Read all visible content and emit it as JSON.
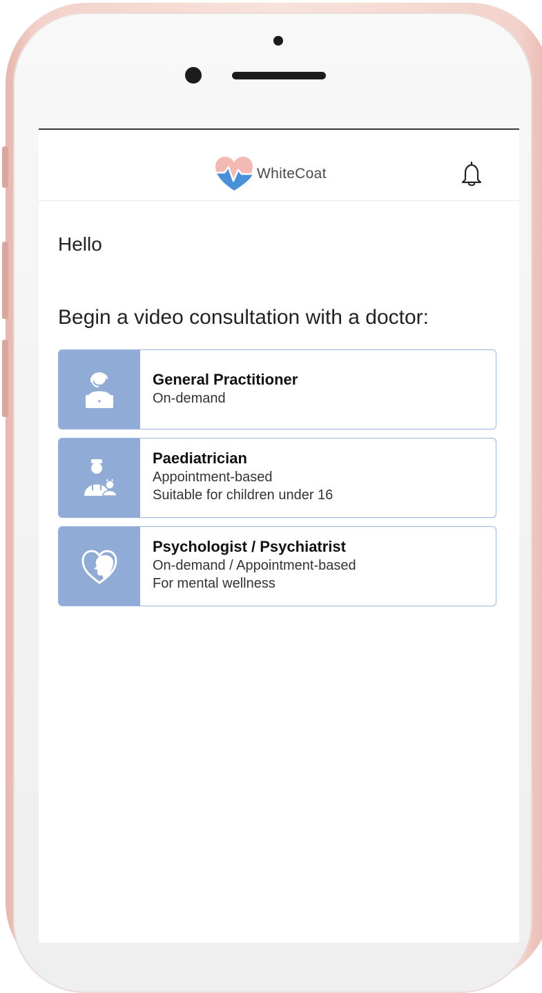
{
  "app": {
    "brand_name": "WhiteCoat",
    "brand_colors": {
      "heart_pink": "#f3b9b3",
      "heart_blue": "#4a90d9"
    }
  },
  "header": {
    "logo_icon": "heart-pulse-logo",
    "notifications_icon": "bell-icon"
  },
  "main": {
    "greeting": "Hello",
    "prompt": "Begin a video consultation with a doctor:",
    "accent_color": "#8fabd6",
    "services": [
      {
        "title": "General Practitioner",
        "lines": [
          "On-demand"
        ],
        "icon": "doctor-headset-laptop-icon"
      },
      {
        "title": "Paediatrician",
        "lines": [
          "Appointment-based",
          "Suitable for children under 16"
        ],
        "icon": "doctor-with-child-icon"
      },
      {
        "title": "Psychologist / Psychiatrist",
        "lines": [
          "On-demand / Appointment-based",
          "For mental wellness"
        ],
        "icon": "heart-head-icon"
      }
    ]
  }
}
